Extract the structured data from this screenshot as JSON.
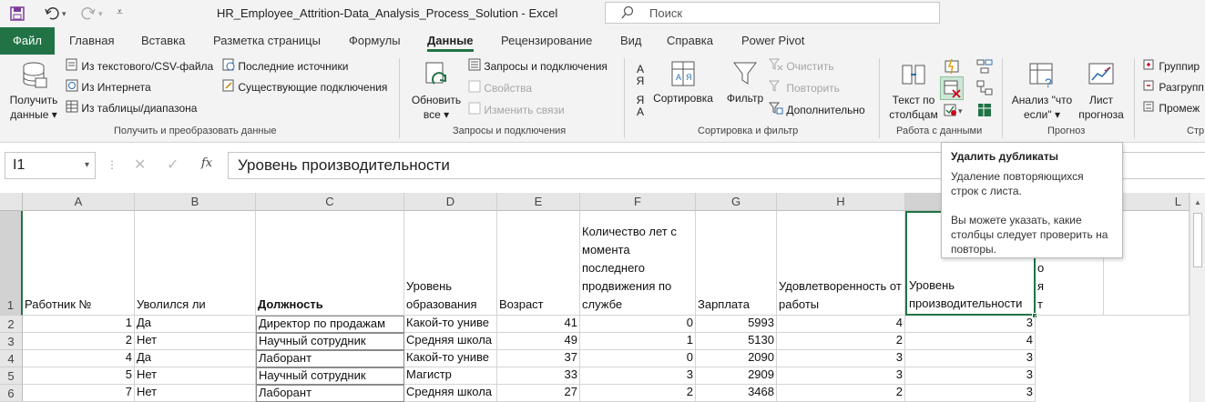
{
  "window": {
    "title": "HR_Employee_Attrition-Data_Analysis_Process_Solution  -  Excel",
    "search_placeholder": "Поиск"
  },
  "menu": [
    "Файл",
    "Главная",
    "Вставка",
    "Разметка страницы",
    "Формулы",
    "Данные",
    "Рецензирование",
    "Вид",
    "Справка",
    "Power Pivot"
  ],
  "ribbon": {
    "get_data": {
      "big1": "Получить",
      "big2": "данные",
      "items": [
        "Из текстового/CSV-файла",
        "Из Интернета",
        "Из таблицы/диапазона",
        "Последние источники",
        "Существующие подключения"
      ],
      "label": "Получить и преобразовать данные"
    },
    "queries": {
      "big1": "Обновить",
      "big2": "все",
      "items": [
        "Запросы и подключения",
        "Свойства",
        "Изменить связи"
      ],
      "label": "Запросы и подключения"
    },
    "sort": {
      "sort": "Сортировка",
      "filter": "Фильтр",
      "items": [
        "Очистить",
        "Повторить",
        "Дополнительно"
      ],
      "label": "Сортировка и фильтр",
      "az_top": "А",
      "az_bot": "Я"
    },
    "tools": {
      "big1": "Текст по",
      "big2": "столбцам",
      "label": "Работа с данными"
    },
    "forecast": {
      "whatif1": "Анализ \"что",
      "whatif2": "если\"",
      "sheet1": "Лист",
      "sheet2": "прогноза",
      "label": "Прогноз"
    },
    "outline": {
      "items": [
        "Группир",
        "Разгрупп",
        "Промеж"
      ],
      "label": "Стр"
    }
  },
  "formula_bar": {
    "name_box": "I1",
    "formula": "Уровень производительности",
    "fx": "fx"
  },
  "columns": [
    "A",
    "B",
    "C",
    "D",
    "E",
    "F",
    "G",
    "H",
    "I",
    "J",
    "L"
  ],
  "rows": [
    "1",
    "2",
    "3",
    "4",
    "5",
    "6"
  ],
  "headers": {
    "a": "Работник №",
    "b": "Уволился ли",
    "c": "Должность",
    "d": "Уровень образования",
    "e": "Возраст",
    "f": "Количество лет с момента последнего продвижения по службе",
    "g": "Зарплата",
    "h": "Удовлетворенность от работы",
    "i": "Уровень производительности",
    "j": "о я т"
  },
  "data": [
    [
      "1",
      "Да",
      "Директор по продажам",
      "Какой-то униве",
      "41",
      "0",
      "5993",
      "4",
      "3"
    ],
    [
      "2",
      "Нет",
      "Научный сотрудник",
      "Средняя школа",
      "49",
      "1",
      "5130",
      "2",
      "4"
    ],
    [
      "4",
      "Да",
      "Лаборант",
      "Какой-то униве",
      "37",
      "0",
      "2090",
      "3",
      "3"
    ],
    [
      "5",
      "Нет",
      "Научный сотрудник",
      "Магистр",
      "33",
      "3",
      "2909",
      "3",
      "3"
    ],
    [
      "7",
      "Нет",
      "Лаборант",
      "Средняя школа",
      "27",
      "2",
      "3468",
      "2",
      "3"
    ]
  ],
  "tooltip": {
    "title": "Удалить дубликаты",
    "line1": "Удаление повторяющихся строк с листа.",
    "line2": "Вы можете указать, какие столбцы следует проверить на повторы."
  },
  "colors": {
    "excel_green": "#217346",
    "selection": "#217346"
  }
}
